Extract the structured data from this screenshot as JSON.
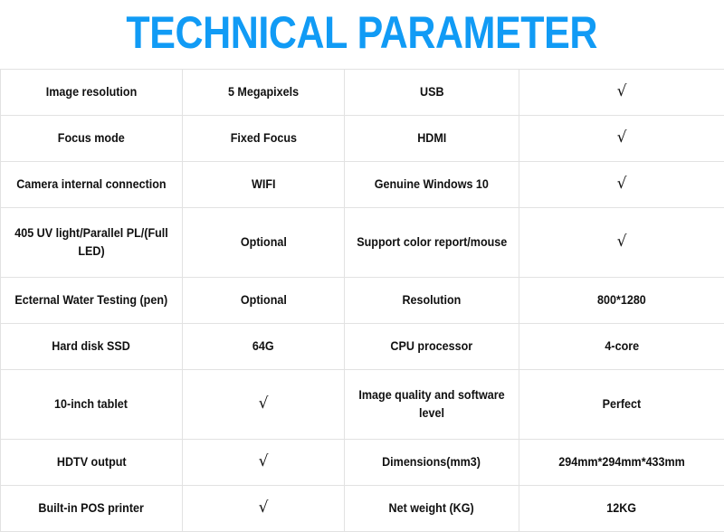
{
  "header": {
    "title": "TECHNICAL PARAMETER",
    "title_color": "#119bf5"
  },
  "table": {
    "columns": 4,
    "check_symbol": "√",
    "border_color": "#e2e2e2",
    "text_color": "#101010",
    "rows": [
      {
        "label_left": "Image resolution",
        "value_left": "5 Megapixels",
        "label_right": "USB",
        "value_right": "√",
        "tall": false,
        "value_right_is_check": true
      },
      {
        "label_left": "Focus mode",
        "value_left": "Fixed Focus",
        "label_right": "HDMI",
        "value_right": "√",
        "tall": false,
        "value_right_is_check": true
      },
      {
        "label_left": "Camera internal connection",
        "value_left": "WIFI",
        "label_right": "Genuine Windows 10",
        "value_right": "√",
        "tall": false,
        "value_right_is_check": true
      },
      {
        "label_left": "405 UV light/Parallel PL/(Full LED)",
        "value_left": "Optional",
        "label_right": "Support color report/mouse",
        "value_right": "√",
        "tall": true,
        "value_right_is_check": true
      },
      {
        "label_left": "Ecternal Water Testing (pen)",
        "value_left": "Optional",
        "label_right": "Resolution",
        "value_right": "800*1280",
        "tall": false,
        "value_right_is_check": false
      },
      {
        "label_left": "Hard disk SSD",
        "value_left": "64G",
        "label_right": "CPU processor",
        "value_right": "4-core",
        "tall": false,
        "value_right_is_check": false
      },
      {
        "label_left": "10-inch tablet",
        "value_left": "√",
        "label_right": "Image quality and software level",
        "value_right": "Perfect",
        "tall": true,
        "value_left_is_check": true,
        "value_right_is_check": false
      },
      {
        "label_left": "HDTV output",
        "value_left": "√",
        "label_right": "Dimensions(mm3)",
        "value_right": "294mm*294mm*433mm",
        "tall": false,
        "value_left_is_check": true,
        "value_right_is_check": false
      },
      {
        "label_left": "Built-in POS printer",
        "value_left": "√",
        "label_right": "Net weight (KG)",
        "value_right": "12KG",
        "tall": false,
        "value_left_is_check": true,
        "value_right_is_check": false
      }
    ]
  }
}
